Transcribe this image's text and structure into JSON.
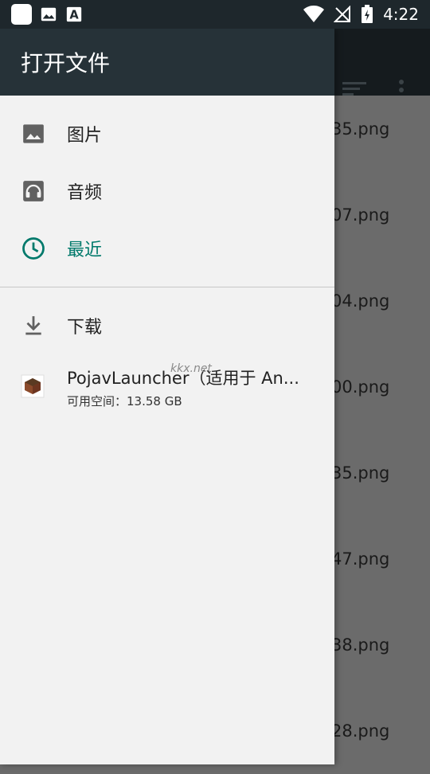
{
  "status_bar": {
    "time": "4:22",
    "icons": [
      "app-square-icon",
      "image-notification-icon",
      "font-notification-icon",
      "wifi-icon",
      "no-signal-icon",
      "battery-charging-icon"
    ]
  },
  "drawer": {
    "title": "打开文件",
    "items": [
      {
        "label": "图片",
        "icon": "image-icon"
      },
      {
        "label": "音频",
        "icon": "headphones-icon"
      },
      {
        "label": "最近",
        "icon": "clock-icon",
        "active": true
      }
    ],
    "download": {
      "label": "下载",
      "icon": "download-icon"
    },
    "storage": {
      "title": "PojavLauncher（适用于 An...",
      "subtitle": "可用空间：13.58 GB",
      "icon": "minecraft-block-icon"
    }
  },
  "background_list": {
    "items": [
      "35.png",
      "07.png",
      "04.png",
      "00.png",
      "35.png",
      "47.png",
      "38.png",
      "28.png"
    ]
  },
  "watermark": "kkx.net",
  "colors": {
    "accent": "#00796b",
    "header": "#263238",
    "status_bar": "#1e272c"
  }
}
